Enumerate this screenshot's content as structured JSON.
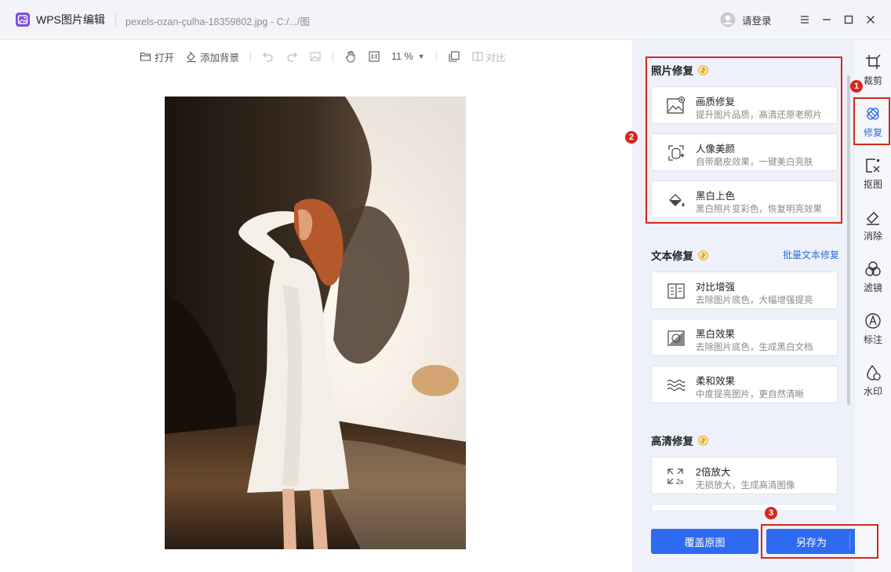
{
  "titlebar": {
    "app_name": "WPS图片编辑",
    "file_name": "pexels-ozan-çulha-18359802.jpg - C:/.../图",
    "login_label": "请登录"
  },
  "toolbar": {
    "open_label": "打开",
    "add_bg_label": "添加背景",
    "zoom_label": "11 %",
    "compare_label": "对比"
  },
  "panel": {
    "photo_section": {
      "title": "照片修复",
      "cards": [
        {
          "title": "画质修复",
          "desc": "提升图片品质，高清还原老照片",
          "icon": "image-enhance-icon"
        },
        {
          "title": "人像美颜",
          "desc": "自带磨皮效果，一键美白亮肤",
          "icon": "portrait-beauty-icon"
        },
        {
          "title": "黑白上色",
          "desc": "黑白照片变彩色，恢复明亮效果",
          "icon": "colorize-icon"
        }
      ]
    },
    "text_section": {
      "title": "文本修复",
      "batch_label": "批量文本修复",
      "cards": [
        {
          "title": "对比增强",
          "desc": "去除图片底色，大幅增强提亮",
          "icon": "contrast-enhance-icon"
        },
        {
          "title": "黑白效果",
          "desc": "去除图片底色，生成黑白文档",
          "icon": "bw-effect-icon"
        },
        {
          "title": "柔和效果",
          "desc": "中度提亮图片，更自然清晰",
          "icon": "soft-effect-icon"
        }
      ]
    },
    "hd_section": {
      "title": "高清修复",
      "cards": [
        {
          "title": "2倍放大",
          "desc": "无损放大，生成高清图像",
          "icon": "upscale-2x-icon",
          "icon_text": "2x"
        }
      ]
    },
    "overwrite_label": "覆盖原图",
    "save_as_label": "另存为"
  },
  "rail": [
    {
      "label": "裁剪",
      "icon": "crop-icon"
    },
    {
      "label": "修复",
      "icon": "repair-icon",
      "active": true
    },
    {
      "label": "抠图",
      "icon": "cutout-icon"
    },
    {
      "label": "消除",
      "icon": "eraser-icon"
    },
    {
      "label": "滤镜",
      "icon": "filter-icon"
    },
    {
      "label": "标注",
      "icon": "annotate-icon"
    },
    {
      "label": "水印",
      "icon": "watermark-icon"
    }
  ],
  "annotations": {
    "badge1": "1",
    "badge2": "2",
    "badge3": "3",
    "color": "#d9261c"
  },
  "colors": {
    "accent": "#2f6bf0",
    "link": "#2f6bd9",
    "panel_bg": "#eef1fa"
  }
}
